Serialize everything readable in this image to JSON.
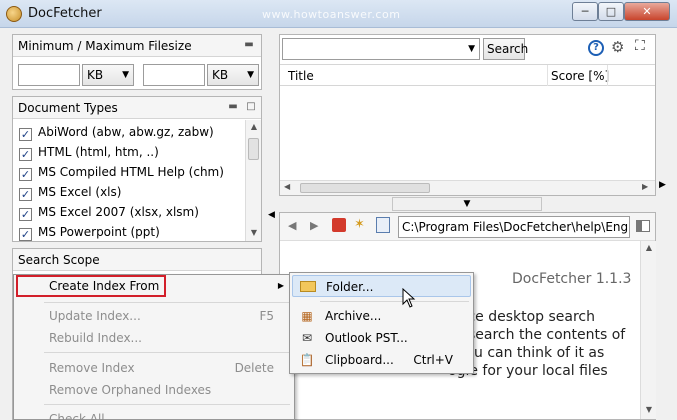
{
  "window": {
    "title": "DocFetcher",
    "watermark": "www.howtoanswer.com",
    "buttons": {
      "minimize": "─",
      "maximize": "□",
      "close": "✕"
    }
  },
  "filesize": {
    "title": "Minimum / Maximum Filesize",
    "min_value": "",
    "max_value": "",
    "min_unit": "KB",
    "max_unit": "KB"
  },
  "doc_types": {
    "title": "Document Types",
    "items": [
      {
        "label": "AbiWord (abw, abw.gz, zabw)",
        "checked": true
      },
      {
        "label": "HTML (html, htm, ..)",
        "checked": true
      },
      {
        "label": "MS Compiled HTML Help (chm)",
        "checked": true
      },
      {
        "label": "MS Excel (xls)",
        "checked": true
      },
      {
        "label": "MS Excel 2007 (xlsx, xlsm)",
        "checked": true
      },
      {
        "label": "MS Powerpoint (ppt)",
        "checked": true
      }
    ]
  },
  "search_scope": {
    "title": "Search Scope"
  },
  "search": {
    "query": "",
    "button_label": "Search",
    "columns": [
      "Title",
      "Score [%]"
    ]
  },
  "preview": {
    "path": "C:\\Program Files\\DocFetcher\\help\\English\\",
    "version": "DocFetcher 1.1.3",
    "line1": "rce desktop search",
    "line2": "search the contents of",
    "line3": "u can think of it as",
    "line4": "ogle for your local files"
  },
  "context_menu": {
    "items": [
      {
        "label": "Create Index From",
        "disabled": false,
        "shortcut": "",
        "submenu": true
      },
      {
        "label": "Update Index...",
        "disabled": true,
        "shortcut": "F5"
      },
      {
        "label": "Rebuild Index...",
        "disabled": true,
        "shortcut": ""
      },
      {
        "label": "Remove Index",
        "disabled": true,
        "shortcut": "Delete"
      },
      {
        "label": "Remove Orphaned Indexes",
        "disabled": true,
        "shortcut": ""
      },
      {
        "label": "Check All",
        "disabled": true,
        "shortcut": ""
      }
    ]
  },
  "submenu": {
    "items": [
      {
        "label": "Folder...",
        "shortcut": "",
        "icon": "folder-icon"
      },
      {
        "label": "Archive...",
        "shortcut": "",
        "icon": "archive-icon"
      },
      {
        "label": "Outlook PST...",
        "shortcut": "",
        "icon": "mail-icon"
      },
      {
        "label": "Clipboard...",
        "shortcut": "Ctrl+V",
        "icon": "clipboard-icon"
      }
    ]
  },
  "colors": {
    "highlight_box": "#d21f2a",
    "menu_hover": "#dce9f7"
  }
}
